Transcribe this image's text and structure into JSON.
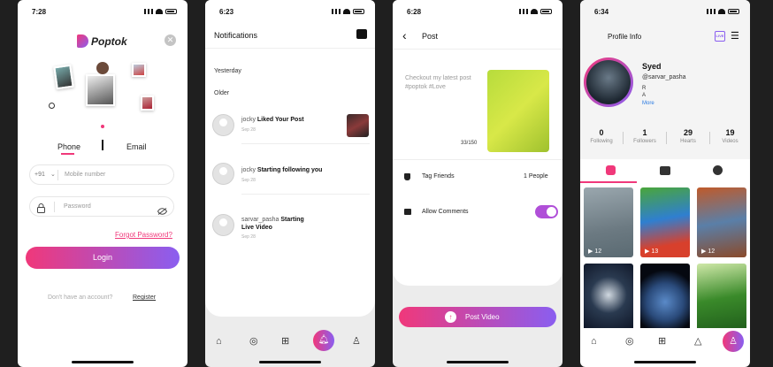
{
  "status_times": [
    "7:28",
    "6:23",
    "6:28",
    "6:34"
  ],
  "login": {
    "logo": "Poptok",
    "tab_phone": "Phone",
    "tab_email": "Email",
    "country_code": "+91",
    "mobile_placeholder": "Mobile number",
    "password_placeholder": "Password",
    "forgot_password": "Forgot Password?",
    "login_button": "Login",
    "no_account": "Don't have an account?",
    "register": "Register"
  },
  "notifications": {
    "title": "Notifications",
    "section_yesterday": "Yesterday",
    "section_older": "Older",
    "items": [
      {
        "user": "jocky",
        "action": "Liked Your Post",
        "date": "Sep 28"
      },
      {
        "user": "jocky",
        "action": "Starting following you",
        "date": "Sep 28"
      },
      {
        "user": "sarvar_pasha",
        "action": "Starting",
        "action2": "Live Video",
        "date": "Sep 28"
      }
    ]
  },
  "post": {
    "title": "Post",
    "caption": "Checkout my latest post #poptok #Love",
    "char_count": "33/150",
    "tag_friends_label": "Tag Friends",
    "tag_friends_value": "1 People",
    "allow_comments_label": "Allow Comments",
    "allow_comments_on": true,
    "post_video_button": "Post Video"
  },
  "profile": {
    "title": "Profile Info",
    "live_badge": "LIVE",
    "name": "Syed",
    "username": "@sarvar_pasha",
    "bio_line1": "R",
    "bio_line2": "A",
    "more_link": "More",
    "stats": [
      {
        "value": "0",
        "label": "Following"
      },
      {
        "value": "1",
        "label": "Followers"
      },
      {
        "value": "29",
        "label": "Hearts"
      },
      {
        "value": "19",
        "label": "Videos"
      }
    ],
    "videos": [
      {
        "count": "12"
      },
      {
        "count": "13"
      },
      {
        "count": "12"
      },
      {
        "count": ""
      },
      {
        "count": ""
      },
      {
        "count": ""
      }
    ]
  },
  "colors": {
    "accent_pink": "#f0387a",
    "accent_purple": "#8a5ef0",
    "link_blue": "#2a7ae2"
  },
  "icons": [
    "home-icon",
    "compass-icon",
    "video-add-icon",
    "bell-icon",
    "profile-icon"
  ]
}
